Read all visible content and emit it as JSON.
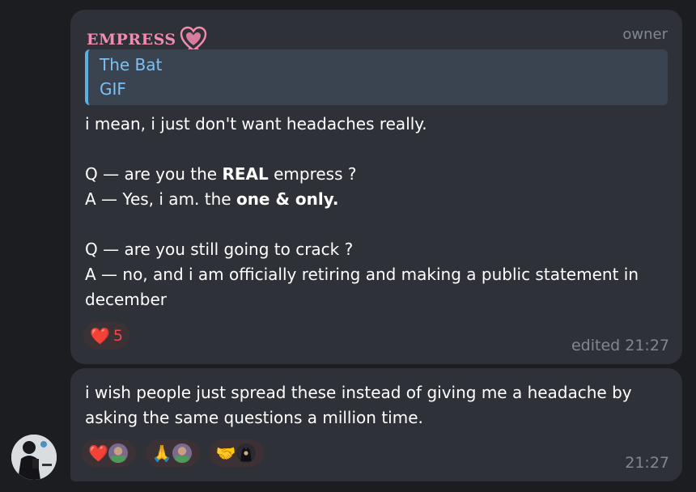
{
  "message1": {
    "sender": "EMPRESS",
    "role": "owner",
    "reply": {
      "title": "The Bat",
      "subtitle": "GIF"
    },
    "lines": [
      "i mean, i just don't want headaches really.",
      "",
      "Q — are you the ",
      "A — Yes, i am. the ",
      "",
      "Q — are you still going to crack ?",
      "A — no, and i am officially retiring and making a public statement in",
      "december"
    ],
    "bold": {
      "real": "REAL",
      "real_after": " empress ?",
      "one_only": "one & only."
    },
    "reaction": {
      "emoji": "❤️",
      "count": "5"
    },
    "meta": "edited 21:27"
  },
  "message2": {
    "lines": [
      "i wish people just spread these instead of giving me a headache by",
      "asking the same questions a million time."
    ],
    "reactions": [
      {
        "emoji": "❤️"
      },
      {
        "emoji": "🙏"
      },
      {
        "emoji": "🤝"
      }
    ],
    "meta": "21:27"
  },
  "colors": {
    "background": "#1c1d21",
    "bubble": "#2e3138",
    "sender": "#f38bb0",
    "reply_accent": "#61aee6",
    "reaction_count": "#f24747"
  }
}
